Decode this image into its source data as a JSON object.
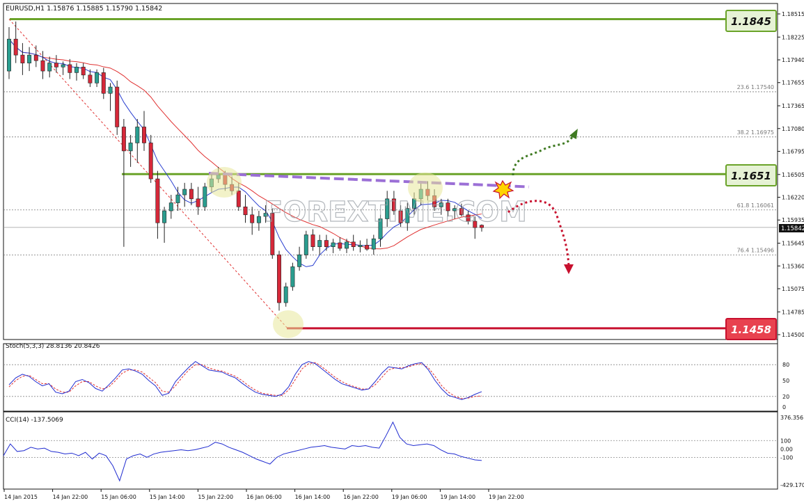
{
  "colors": {
    "bull": "#2a9d8f",
    "bear": "#d62839",
    "sma_red": "#e03030",
    "sma_blue": "#2a3fd0",
    "green_level": "#6aa329",
    "red_level": "#c8102e",
    "purple_trend": "#9b6fd6",
    "stoch_main": "#1f2bd0",
    "stoch_signal": "#e03030",
    "cci": "#1f2bd0",
    "fib": "#777777",
    "watermark": "#9aa0a6",
    "star": "#ffd400"
  },
  "chart_data": [
    {
      "type": "candlestick",
      "title": "EURUSD,H1 1.15876 1.15885 1.15790 1.15842",
      "ylim": [
        1.145,
        1.18515
      ],
      "y_ticks": [
        "1.18515",
        "1.18225",
        "1.17940",
        "1.17655",
        "1.17365",
        "1.17080",
        "1.16795",
        "1.16505",
        "1.16220",
        "1.15935",
        "1.15645",
        "1.15360",
        "1.15075",
        "1.14785",
        "1.14500"
      ],
      "x_ticks": [
        "14 Jan 2015",
        "14 Jan 22:00",
        "15 Jan 06:00",
        "15 Jan 14:00",
        "15 Jan 22:00",
        "16 Jan 06:00",
        "16 Jan 14:00",
        "16 Jan 22:00",
        "19 Jan 06:00",
        "19 Jan 14:00",
        "19 Jan 22:00"
      ],
      "current_price": "1.15842",
      "levels": [
        {
          "label": "1.1845",
          "value": 1.1845,
          "kind": "resistance"
        },
        {
          "label": "1.1651",
          "value": 1.1651,
          "kind": "pivot"
        },
        {
          "label": "1.1458",
          "value": 1.1458,
          "kind": "support"
        }
      ],
      "fib_levels": [
        {
          "label": "23.6 1.17540",
          "value": 1.1754
        },
        {
          "label": "38.2 1.16975",
          "value": 1.16975
        },
        {
          "label": "61.8 1.16061",
          "value": 1.16061
        },
        {
          "label": "76.4 1.15496",
          "value": 1.15496
        }
      ],
      "candles": [
        [
          1.178,
          1.1835,
          1.177,
          1.182
        ],
        [
          1.182,
          1.1842,
          1.179,
          1.18
        ],
        [
          1.18,
          1.1815,
          1.1775,
          1.179
        ],
        [
          1.179,
          1.181,
          1.178,
          1.18
        ],
        [
          1.18,
          1.1812,
          1.1785,
          1.1793
        ],
        [
          1.1793,
          1.1805,
          1.177,
          1.178
        ],
        [
          1.178,
          1.1798,
          1.1772,
          1.179
        ],
        [
          1.179,
          1.18,
          1.1778,
          1.1785
        ],
        [
          1.1785,
          1.1792,
          1.1775,
          1.1788
        ],
        [
          1.1788,
          1.1795,
          1.177,
          1.1778
        ],
        [
          1.1778,
          1.179,
          1.1768,
          1.1785
        ],
        [
          1.1785,
          1.179,
          1.177,
          1.1775
        ],
        [
          1.1775,
          1.1782,
          1.176,
          1.1765
        ],
        [
          1.1765,
          1.1782,
          1.176,
          1.1778
        ],
        [
          1.1778,
          1.1784,
          1.1745,
          1.1752
        ],
        [
          1.1752,
          1.1765,
          1.173,
          1.176
        ],
        [
          1.176,
          1.1768,
          1.17,
          1.171
        ],
        [
          1.171,
          1.172,
          1.156,
          1.168
        ],
        [
          1.168,
          1.17,
          1.166,
          1.169
        ],
        [
          1.169,
          1.172,
          1.1665,
          1.171
        ],
        [
          1.171,
          1.173,
          1.168,
          1.169
        ],
        [
          1.169,
          1.17,
          1.164,
          1.1645
        ],
        [
          1.1645,
          1.1655,
          1.157,
          1.159
        ],
        [
          1.159,
          1.161,
          1.1565,
          1.1605
        ],
        [
          1.1605,
          1.1625,
          1.1595,
          1.1615
        ],
        [
          1.1615,
          1.1635,
          1.1605,
          1.1625
        ],
        [
          1.1625,
          1.164,
          1.161,
          1.1632
        ],
        [
          1.1632,
          1.164,
          1.1612,
          1.162
        ],
        [
          1.162,
          1.1635,
          1.16,
          1.161
        ],
        [
          1.161,
          1.164,
          1.1605,
          1.1635
        ],
        [
          1.1635,
          1.1652,
          1.1628,
          1.1645
        ],
        [
          1.1645,
          1.166,
          1.164,
          1.165
        ],
        [
          1.165,
          1.1655,
          1.163,
          1.1638
        ],
        [
          1.1638,
          1.1648,
          1.1625,
          1.163
        ],
        [
          1.163,
          1.164,
          1.1605,
          1.161
        ],
        [
          1.161,
          1.1625,
          1.159,
          1.16
        ],
        [
          1.16,
          1.161,
          1.1575,
          1.159
        ],
        [
          1.159,
          1.1605,
          1.158,
          1.1598
        ],
        [
          1.1598,
          1.1612,
          1.159,
          1.1602
        ],
        [
          1.1602,
          1.1608,
          1.1545,
          1.155
        ],
        [
          1.155,
          1.1555,
          1.148,
          1.149
        ],
        [
          1.149,
          1.1515,
          1.1485,
          1.151
        ],
        [
          1.151,
          1.154,
          1.1505,
          1.1535
        ],
        [
          1.1535,
          1.156,
          1.153,
          1.155
        ],
        [
          1.155,
          1.158,
          1.1545,
          1.1575
        ],
        [
          1.1575,
          1.1582,
          1.1555,
          1.156
        ],
        [
          1.156,
          1.1575,
          1.155,
          1.1568
        ],
        [
          1.1568,
          1.1575,
          1.1555,
          1.156
        ],
        [
          1.156,
          1.157,
          1.1552,
          1.1565
        ],
        [
          1.1565,
          1.1572,
          1.1555,
          1.1558
        ],
        [
          1.1558,
          1.157,
          1.1552,
          1.1566
        ],
        [
          1.1566,
          1.1575,
          1.1555,
          1.156
        ],
        [
          1.156,
          1.1568,
          1.1553,
          1.1562
        ],
        [
          1.1562,
          1.157,
          1.1555,
          1.1557
        ],
        [
          1.1557,
          1.1575,
          1.155,
          1.157
        ],
        [
          1.157,
          1.16,
          1.156,
          1.1595
        ],
        [
          1.1595,
          1.163,
          1.1585,
          1.162
        ],
        [
          1.162,
          1.163,
          1.16,
          1.1605
        ],
        [
          1.1605,
          1.1612,
          1.1585,
          1.159
        ],
        [
          1.159,
          1.1615,
          1.158,
          1.1608
        ],
        [
          1.1608,
          1.1628,
          1.16,
          1.162
        ],
        [
          1.162,
          1.164,
          1.1612,
          1.1632
        ],
        [
          1.1632,
          1.1642,
          1.1618,
          1.1624
        ],
        [
          1.1624,
          1.1632,
          1.1605,
          1.161
        ],
        [
          1.161,
          1.162,
          1.16,
          1.1615
        ],
        [
          1.1615,
          1.162,
          1.1598,
          1.1605
        ],
        [
          1.1605,
          1.1612,
          1.1595,
          1.1608
        ],
        [
          1.1608,
          1.1614,
          1.1598,
          1.16
        ],
        [
          1.16,
          1.1605,
          1.1588,
          1.1592
        ],
        [
          1.1592,
          1.1598,
          1.157,
          1.1584
        ],
        [
          1.1587,
          1.1588,
          1.1579,
          1.1584
        ]
      ]
    },
    {
      "type": "line",
      "title": "Stoch(5,3,3) 28.8136 20.8426",
      "ylim": [
        0,
        100
      ],
      "y_ticks": [
        "80",
        "50",
        "20",
        "0"
      ],
      "series": [
        {
          "values": [
            42,
            55,
            62,
            58,
            48,
            40,
            44,
            28,
            25,
            30,
            48,
            52,
            46,
            35,
            30,
            42,
            55,
            70,
            72,
            68,
            62,
            50,
            40,
            22,
            26,
            48,
            62,
            75,
            86,
            78,
            70,
            68,
            66,
            60,
            55,
            45,
            36,
            28,
            24,
            22,
            20,
            24,
            38,
            62,
            80,
            86,
            82,
            72,
            62,
            52,
            44,
            40,
            36,
            32,
            34,
            48,
            64,
            76,
            74,
            72,
            78,
            82,
            84,
            70,
            50,
            34,
            22,
            18,
            14,
            18,
            24,
            29
          ]
        },
        {
          "values": [
            38,
            50,
            58,
            60,
            52,
            44,
            44,
            34,
            28,
            28,
            40,
            48,
            48,
            40,
            34,
            38,
            50,
            64,
            70,
            70,
            66,
            56,
            46,
            30,
            28,
            40,
            56,
            70,
            80,
            80,
            74,
            70,
            68,
            63,
            58,
            50,
            40,
            32,
            26,
            24,
            22,
            22,
            32,
            52,
            72,
            82,
            84,
            76,
            66,
            56,
            48,
            42,
            38,
            34,
            34,
            42,
            56,
            70,
            74,
            74,
            76,
            80,
            82,
            74,
            58,
            40,
            28,
            20,
            16,
            17,
            20,
            21
          ]
        }
      ]
    },
    {
      "type": "line",
      "title": "CCI(14) -137.5069",
      "ylim": [
        -429.17,
        376.356
      ],
      "y_ticks": [
        "376.356",
        "100",
        "0.00",
        "-100",
        "-429.170"
      ],
      "series": [
        {
          "values": [
            -80,
            60,
            -30,
            -20,
            20,
            0,
            10,
            -30,
            -40,
            -60,
            -50,
            -80,
            -40,
            -120,
            -50,
            -80,
            -200,
            -380,
            -120,
            -80,
            -60,
            -100,
            -60,
            -40,
            -30,
            -20,
            -10,
            -20,
            -10,
            10,
            30,
            80,
            60,
            20,
            -10,
            -40,
            -80,
            -120,
            -150,
            -180,
            -100,
            -60,
            -40,
            -20,
            0,
            20,
            30,
            40,
            20,
            10,
            0,
            40,
            30,
            40,
            20,
            10,
            160,
            320,
            140,
            60,
            40,
            50,
            60,
            40,
            -10,
            -50,
            -60,
            -90,
            -110,
            -130,
            -137
          ]
        }
      ]
    }
  ],
  "annotations": {
    "watermark": "FOREXTIME.COM"
  }
}
